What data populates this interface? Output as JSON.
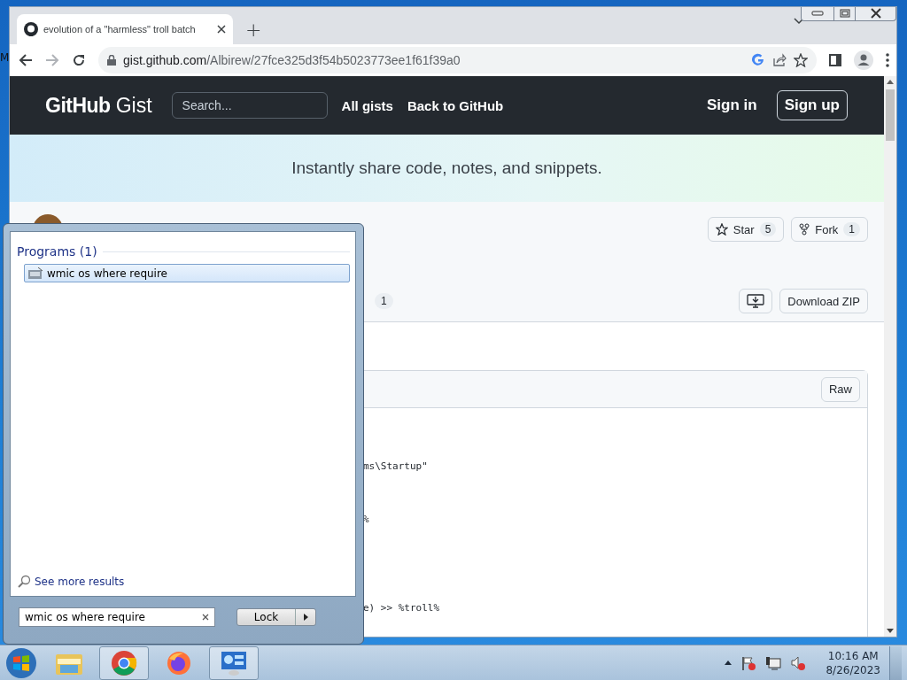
{
  "desktop": {
    "label": "M"
  },
  "browser": {
    "tab": {
      "title": "evolution of a \"harmless\" troll batch",
      "selected": true
    },
    "new_tab": "+",
    "url": {
      "host": "gist.github.com",
      "path": "/Albirew/27fce325d3f54b5023773ee1f61f39a0"
    }
  },
  "site_header": {
    "logo": "GitHub",
    "logo_suffix": "Gist",
    "search": {
      "placeholder": "Search..."
    },
    "nav": [
      "All gists",
      "Back to GitHub"
    ],
    "sign_in": "Sign in",
    "sign_up": "Sign up"
  },
  "banner": {
    "text": "Instantly share code, notes, and snippets."
  },
  "gist": {
    "star": {
      "label": "Star",
      "count": "5"
    },
    "fork": {
      "label": "Fork",
      "count": "1"
    },
    "tab_count": "1",
    "download": "Download ZIP"
  },
  "file": {
    "raw": "Raw",
    "code_lines": [
      {
        "text": "ms\\Startup\""
      },
      {
        "text": "%"
      },
      {
        "text": "e) >> %troll%"
      }
    ]
  },
  "start_menu": {
    "section": "Programs (1)",
    "results": [
      {
        "label": "wmic os where require",
        "selected": true
      }
    ],
    "see_more": "See more results",
    "search": {
      "value": "wmic os where require"
    },
    "power_button": "Lock"
  },
  "taskbar": {
    "apps": [
      {
        "kind": "explorer",
        "active": false
      },
      {
        "kind": "chrome",
        "active": true
      },
      {
        "kind": "firefox",
        "active": false
      },
      {
        "kind": "control",
        "active": true
      }
    ],
    "clock": {
      "time": "10:16 AM",
      "date": "8/26/2023"
    }
  }
}
